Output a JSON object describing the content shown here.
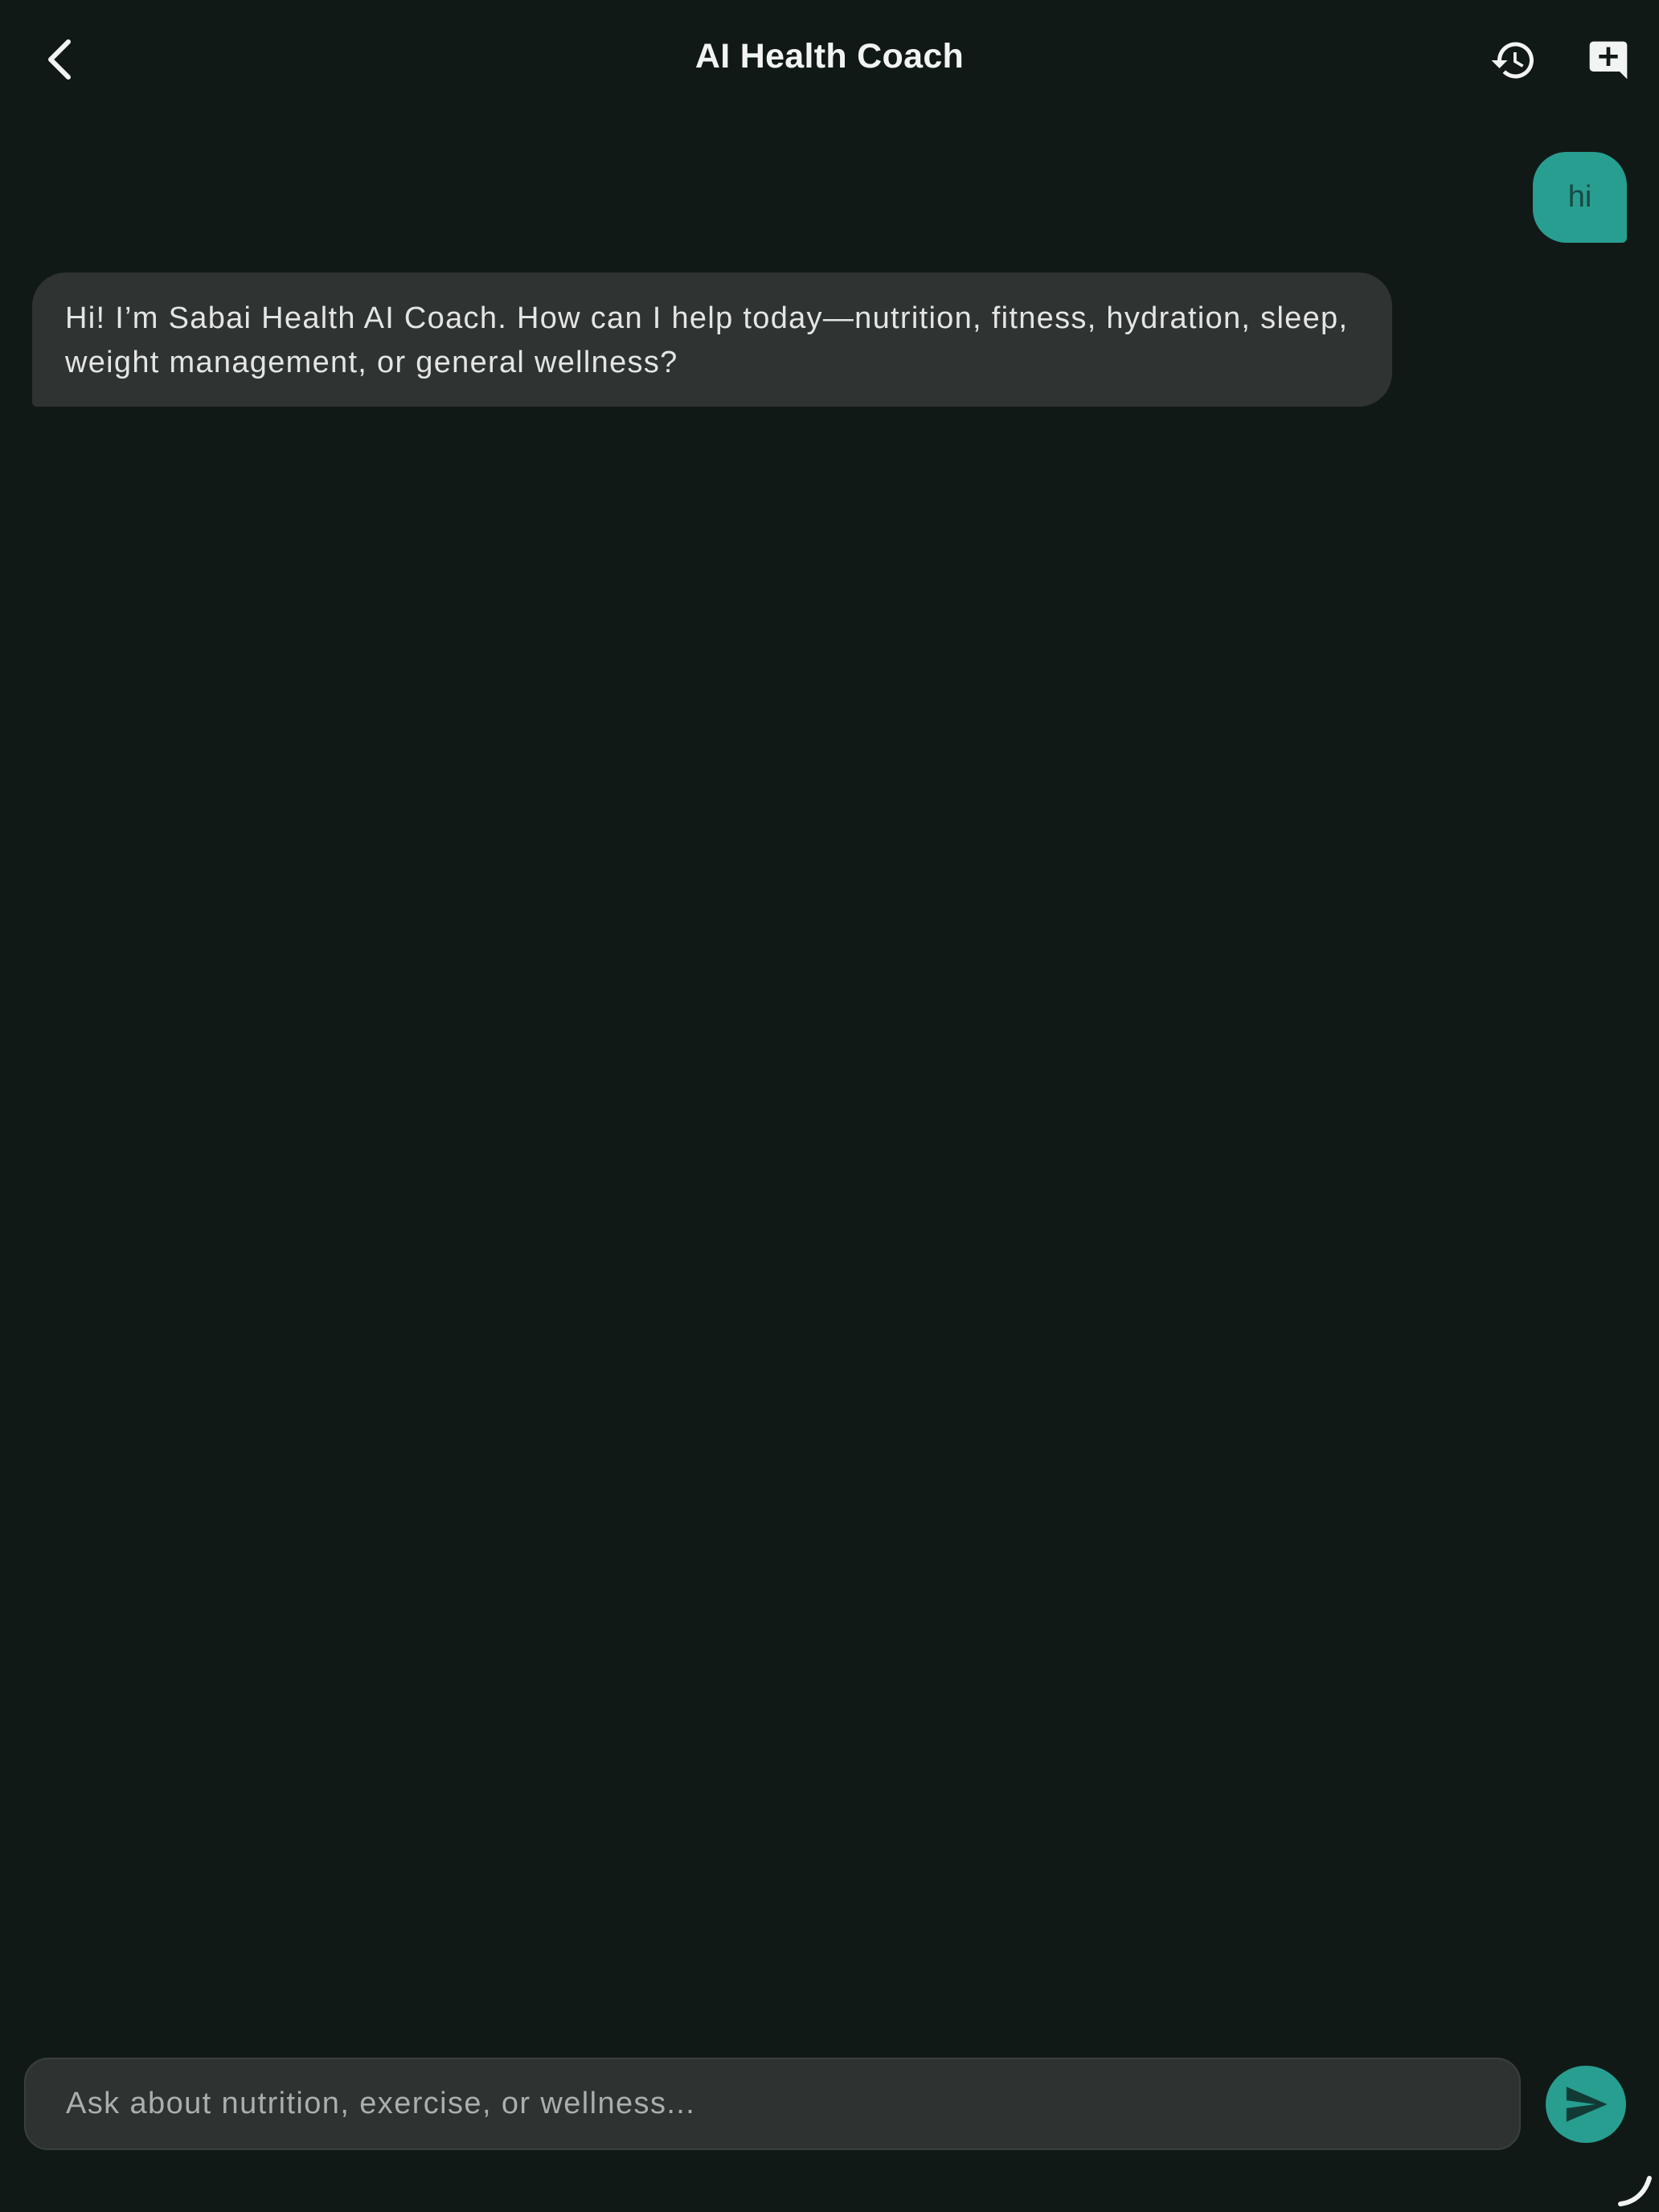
{
  "header": {
    "title": "AI Health Coach",
    "back_icon": "chevron-left-icon",
    "history_icon": "history-icon",
    "new_chat_icon": "new-chat-icon"
  },
  "messages": [
    {
      "role": "user",
      "text": "hi"
    },
    {
      "role": "assistant",
      "text": "Hi! I’m Sabai Health AI Coach. How can I help today—nutrition, fitness, hydration, sleep, weight management, or general wellness?"
    }
  ],
  "composer": {
    "placeholder": "Ask about nutrition, exercise, or wellness...",
    "value": "",
    "send_icon": "send-icon"
  },
  "colors": {
    "background": "#111917",
    "accent": "#279e90",
    "bubble_assistant": "#2f3332",
    "input_background": "#2e3231",
    "text_primary": "#e6e8e7",
    "text_placeholder": "#a9afad"
  }
}
